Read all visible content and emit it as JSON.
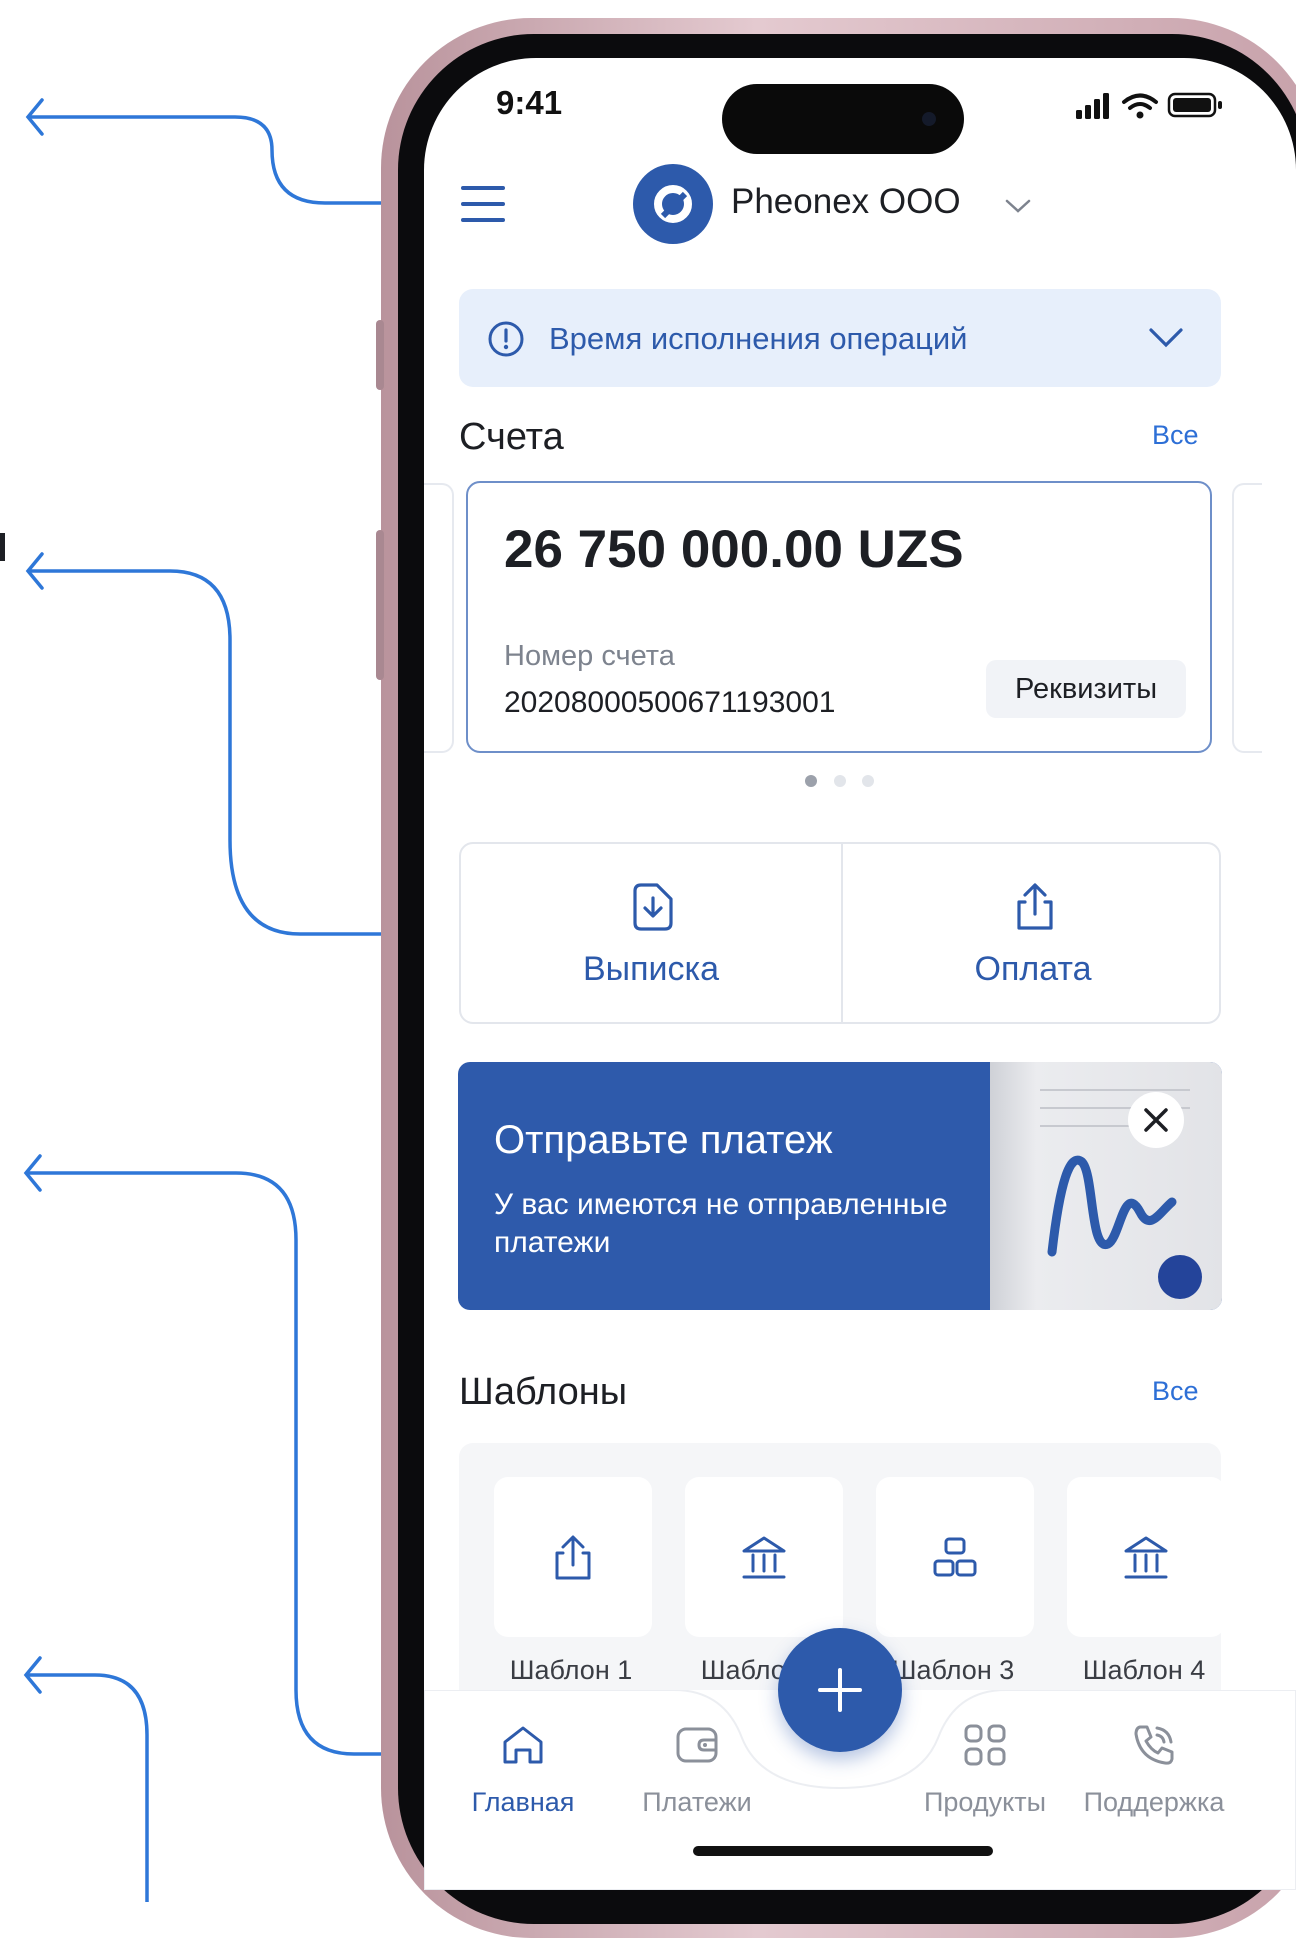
{
  "status_bar": {
    "time": "9:41"
  },
  "header": {
    "company": "Pheonex OOO"
  },
  "notice": {
    "text": "Время исполнения операций"
  },
  "accounts": {
    "title": "Счета",
    "all_link": "Все",
    "card": {
      "amount": "26 750 000.00 UZS",
      "account_label": "Номер счета",
      "account_number": "20208000500671193001",
      "details_button": "Реквизиты"
    }
  },
  "actions": {
    "statement": "Выписка",
    "payment": "Оплата"
  },
  "promo": {
    "title": "Отправьте платеж",
    "text": "У вас имеются не отправленные платежи"
  },
  "templates": {
    "title": "Шаблоны",
    "all_link": "Все",
    "items": [
      {
        "label": "Шаблон 1",
        "icon": "share-upload-icon"
      },
      {
        "label": "Шаблон 2",
        "icon": "bank-icon"
      },
      {
        "label": "Шаблон 3",
        "icon": "blocks-icon"
      },
      {
        "label": "Шаблон 4",
        "icon": "bank-icon"
      }
    ]
  },
  "tabs": [
    {
      "label": "Главная",
      "icon": "home-icon",
      "active": true
    },
    {
      "label": "Платежи",
      "icon": "wallet-icon",
      "active": false
    },
    {
      "label": "Продукты",
      "icon": "grid-icon",
      "active": false
    },
    {
      "label": "Поддержка",
      "icon": "phone-call-icon",
      "active": false
    }
  ],
  "colors": {
    "accent": "#2d5aab",
    "link": "#2d6fd6",
    "annotation": "#2e77d8",
    "notice_bg": "#e7effb"
  }
}
